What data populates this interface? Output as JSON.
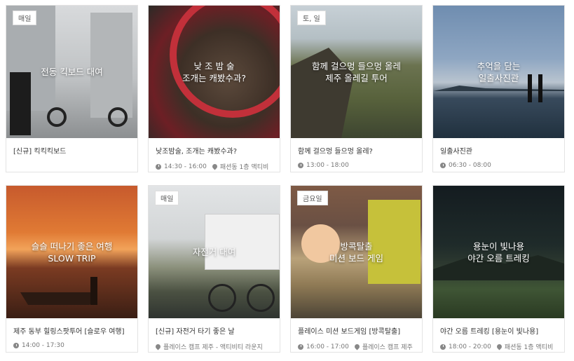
{
  "cards": [
    {
      "badge": "매일",
      "overlay": "전동 킥보드 대여",
      "title": "[신규] 킥킥킥보드",
      "time": "",
      "location": ""
    },
    {
      "badge": "",
      "overlay": "낮 조 밤 술\n조개는 캐봤수과?",
      "title": "낮조밤술, 조개는 캐봤수과?",
      "time": "14:30 - 16:00",
      "location": "패션동 1층 액티비"
    },
    {
      "badge": "토, 일",
      "overlay": "함께 걸으멍 들으멍 올레\n제주 올레길 투어",
      "title": "함께 걸으멍 들으멍 올레?",
      "time": "13:00 - 18:00",
      "location": ""
    },
    {
      "badge": "",
      "overlay": "추억을 담는\n일출사진관",
      "title": "일출사진관",
      "time": "06:30 - 08:00",
      "location": ""
    },
    {
      "badge": "",
      "overlay": "슬슬 떠나기 좋은 여행\nSLOW TRIP",
      "title": "제주 동부 힐링스팟투어 [슬로우 여행]",
      "time": "14:00 - 17:30",
      "location": ""
    },
    {
      "badge": "매일",
      "overlay": "자전거 대여",
      "title": "[신규] 자전거 타기 좋은 날",
      "time": "",
      "location": "플레이스 캠프 제주 - 액티비티 라운지"
    },
    {
      "badge": "금요일",
      "overlay": "방콕탈출\n미션 보드 게임",
      "title": "플레이스 미션 보드게임 [방콕탈출]",
      "time": "16:00 - 17:00",
      "location": "플레이스 캠프 제주"
    },
    {
      "badge": "",
      "overlay": "용눈이 빛나용\n야간 오름 트레킹",
      "title": "야간 오름 트레킹 [용눈이 빛나용]",
      "time": "18:00 - 20:00",
      "location": "패션동 1층 액티비"
    }
  ]
}
